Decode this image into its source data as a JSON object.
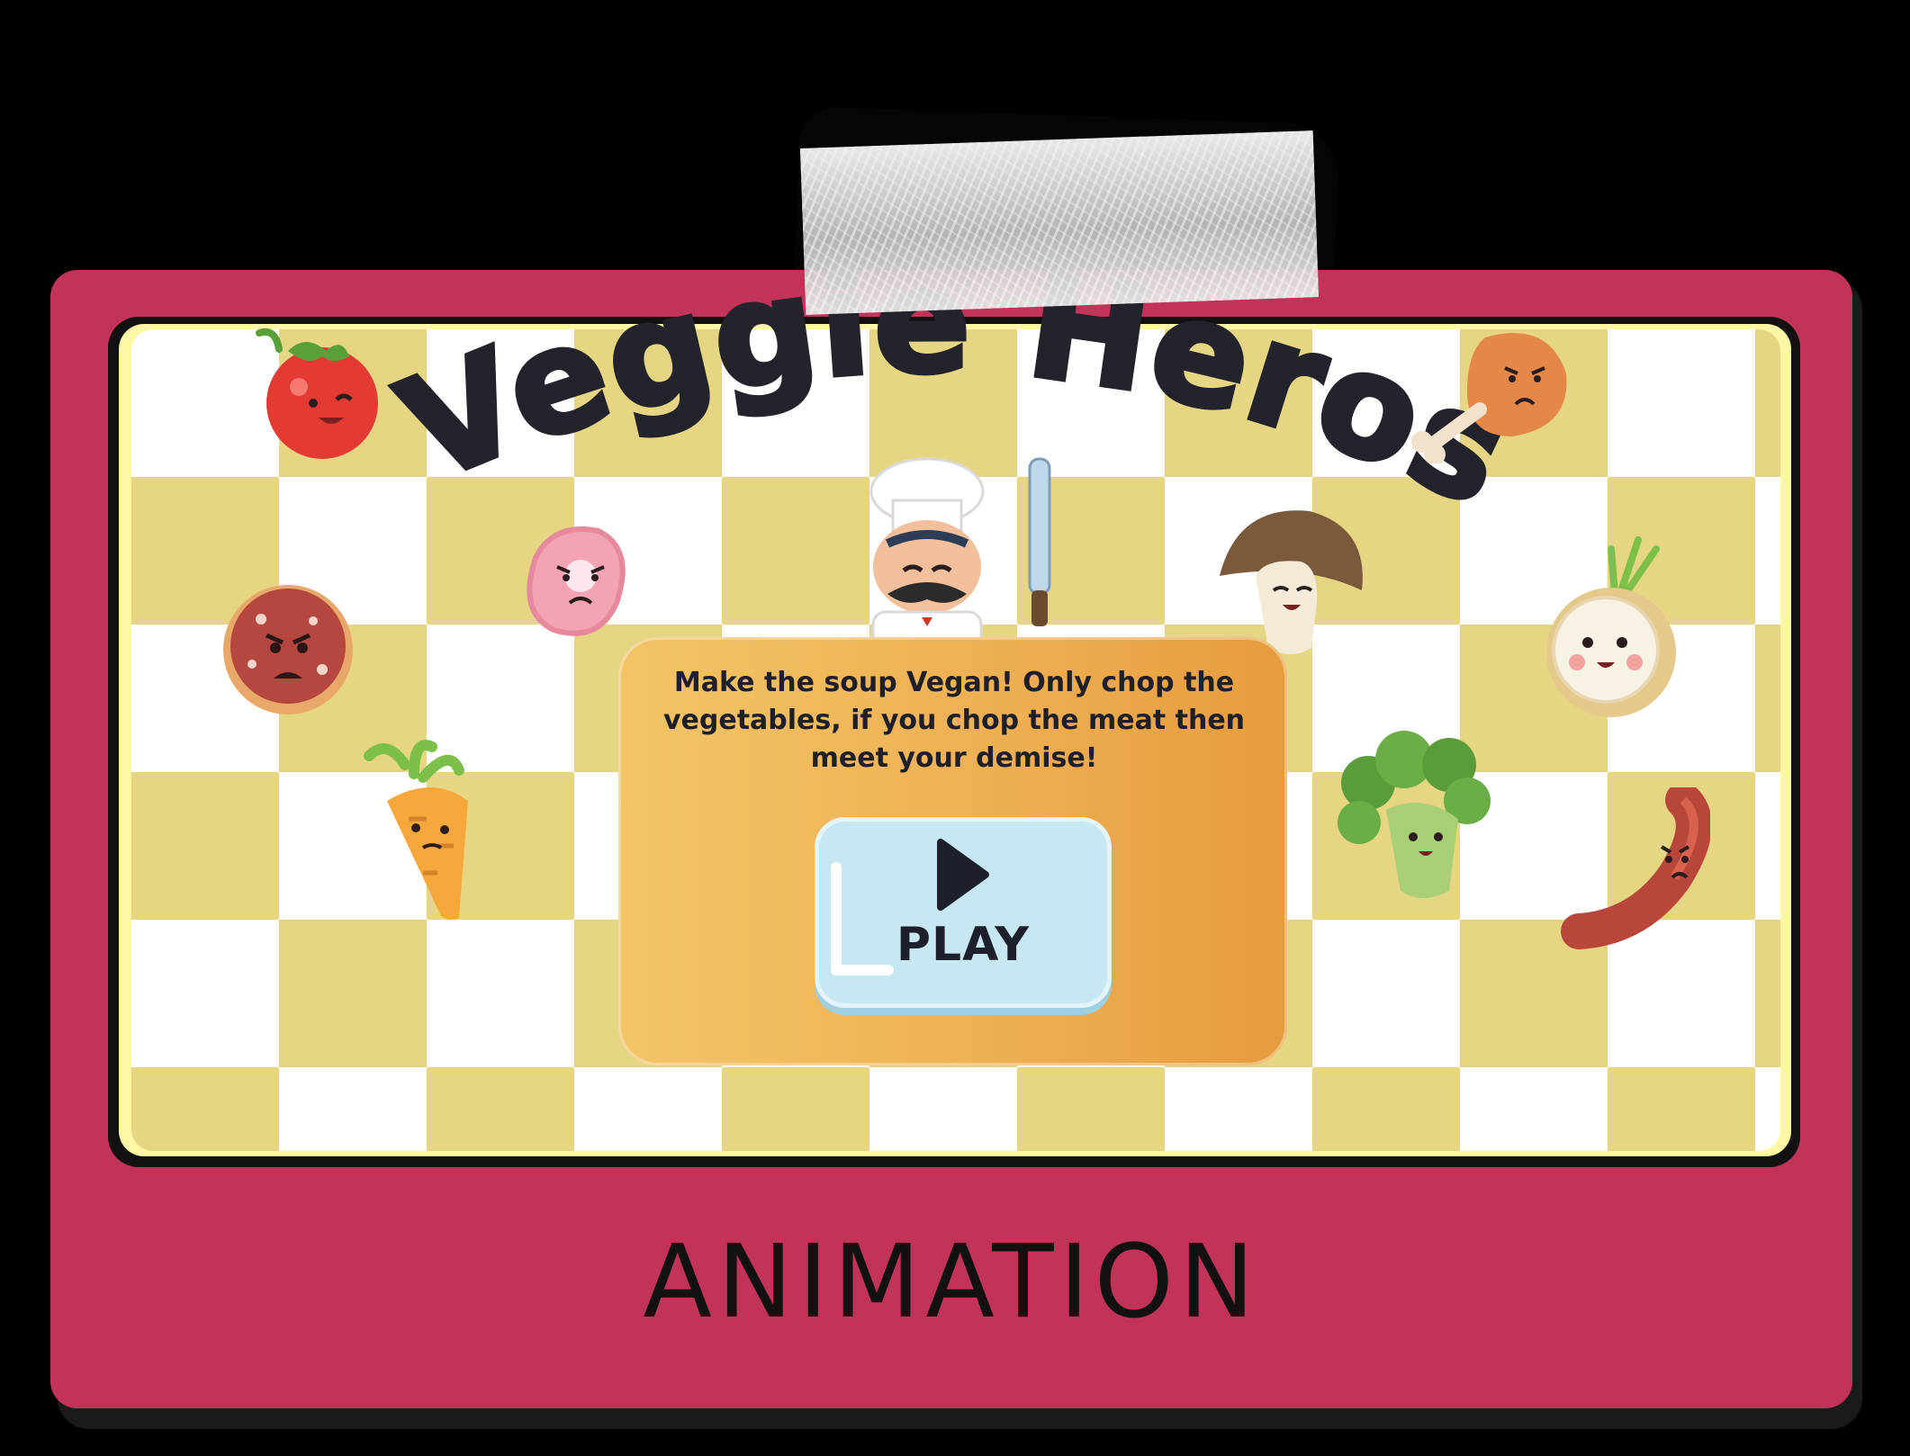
{
  "game": {
    "title": "Veggie Heros",
    "instructions": "Make the soup Vegan! Only chop the vegetables, if you chop the meat then meet your demise!",
    "play_label": "PLAY"
  },
  "footer": {
    "label": "ANIMATION"
  },
  "characters": [
    {
      "name": "tomato",
      "kind": "vegetable",
      "mood": "happy"
    },
    {
      "name": "salami",
      "kind": "meat",
      "mood": "angry"
    },
    {
      "name": "carrot",
      "kind": "vegetable",
      "mood": "worried"
    },
    {
      "name": "ham",
      "kind": "meat",
      "mood": "angry"
    },
    {
      "name": "chef",
      "kind": "mascot",
      "mood": "happy"
    },
    {
      "name": "mushroom",
      "kind": "vegetable",
      "mood": "happy"
    },
    {
      "name": "chicken-drumstick",
      "kind": "meat",
      "mood": "angry"
    },
    {
      "name": "onion",
      "kind": "vegetable",
      "mood": "happy"
    },
    {
      "name": "broccoli",
      "kind": "vegetable",
      "mood": "happy"
    },
    {
      "name": "sausage",
      "kind": "meat",
      "mood": "angry"
    }
  ],
  "colors": {
    "frame": "#c2335a",
    "board_checker": "#e6d684",
    "card": "#eeae52",
    "play_button": "#c7e7f2",
    "title_text": "#23232b"
  }
}
